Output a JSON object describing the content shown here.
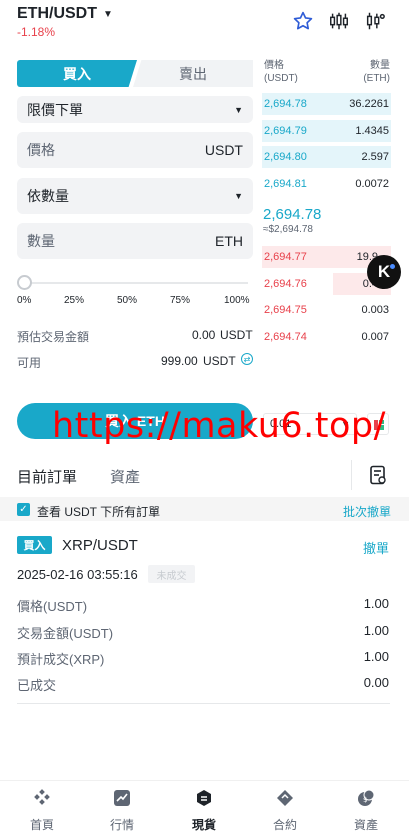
{
  "header": {
    "pair": "ETH/USDT",
    "change": "-1.18%"
  },
  "trade": {
    "tab_buy": "買入",
    "tab_sell": "賣出",
    "order_type": "限價下單",
    "price_label": "價格",
    "price_unit": "USDT",
    "qty_mode": "依數量",
    "qty_label": "數量",
    "qty_unit": "ETH",
    "percents": [
      "0%",
      "25%",
      "50%",
      "75%",
      "100%"
    ],
    "slider_fraction": 0,
    "est_label": "預估交易金額",
    "est_value": "0.00",
    "est_unit": "USDT",
    "avail_label": "可用",
    "avail_value": "999.00",
    "avail_unit": "USDT",
    "buy_button": "買入 ETH"
  },
  "orderbook": {
    "price_header": "價格",
    "price_header_unit": "(USDT)",
    "qty_header": "數量",
    "qty_header_unit": "(ETH)",
    "bids": [
      {
        "price": "2,694.78",
        "qty": "36.2261",
        "depth": 1.0
      },
      {
        "price": "2,694.79",
        "qty": "1.4345",
        "depth": 1.0
      },
      {
        "price": "2,694.80",
        "qty": "2.597",
        "depth": 1.0
      },
      {
        "price": "2,694.81",
        "qty": "0.0072",
        "depth": 0.0
      }
    ],
    "mid_price": "2,694.78",
    "mid_fiat": "≈$2,694.78",
    "asks": [
      {
        "price": "2,694.77",
        "qty": "19.9…",
        "depth": 1.0
      },
      {
        "price": "2,694.76",
        "qty": "0.4…",
        "depth": 0.45
      },
      {
        "price": "2,694.75",
        "qty": "0.003",
        "depth": 0.0
      },
      {
        "price": "2,694.74",
        "qty": "0.007",
        "depth": 0.0
      }
    ],
    "depth_value": "0.01"
  },
  "fab_label": "K",
  "watermark": "https://maku6.top/",
  "orders": {
    "tab_current": "目前訂單",
    "tab_assets": "資產",
    "filter_text": "查看 USDT 下所有訂單",
    "cancel_all": "批次撤單",
    "item": {
      "side": "買入",
      "symbol": "XRP/USDT",
      "cancel": "撤單",
      "time": "2025-02-16 03:55:16",
      "status": "未成交",
      "rows": [
        {
          "label": "價格(USDT)",
          "value": "1.00"
        },
        {
          "label": "交易金額(USDT)",
          "value": "1.00"
        },
        {
          "label": "預計成交(XRP)",
          "value": "1.00"
        },
        {
          "label": "已成交",
          "value": "0.00"
        }
      ]
    }
  },
  "nav": {
    "items": [
      {
        "label": "首頁",
        "icon": "home-icon"
      },
      {
        "label": "行情",
        "icon": "market-icon"
      },
      {
        "label": "現貨",
        "icon": "spot-icon"
      },
      {
        "label": "合約",
        "icon": "futures-icon"
      },
      {
        "label": "資產",
        "icon": "assets-icon"
      }
    ],
    "active_index": 2
  },
  "colors": {
    "accent": "#19a8c9",
    "down": "#e8414b",
    "bid_bg": "#e4f5fa",
    "ask_bg": "#fde9ea"
  }
}
